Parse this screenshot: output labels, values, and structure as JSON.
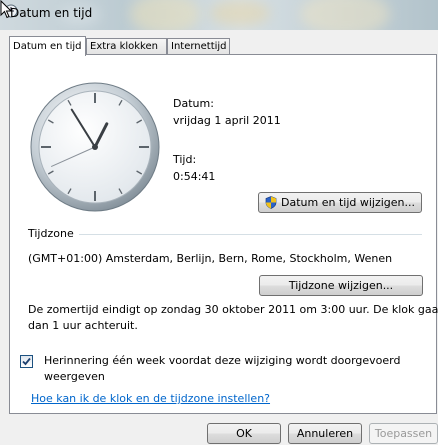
{
  "window": {
    "title": "Datum en tijd"
  },
  "tabs": [
    {
      "label": "Datum en tijd"
    },
    {
      "label": "Extra klokken"
    },
    {
      "label": "Internettijd"
    }
  ],
  "clock": {
    "hour": 0,
    "minute": 54,
    "second": 41
  },
  "date_section": {
    "date_label": "Datum:",
    "date_value": "vrijdag 1 april 2011",
    "time_label": "Tijd:",
    "time_value": "0:54:41",
    "change_button": "Datum en tijd wijzigen..."
  },
  "timezone": {
    "heading": "Tijdzone",
    "value": "(GMT+01:00) Amsterdam, Berlijn, Bern, Rome, Stockholm, Wenen",
    "change_button": "Tijdzone wijzigen...",
    "dst_line1": "De zomertijd eindigt op zondag 30 oktober 2011 om 3:00 uur. De klok gaat",
    "dst_line2": "dan 1 uur achteruit."
  },
  "reminder": {
    "checked": true,
    "line1": "Herinnering één week voordat deze wijziging wordt doorgevoerd",
    "line2": "weergeven"
  },
  "help_link": "Hoe kan ik de klok en de tijdzone instellen?",
  "footer": {
    "ok": "OK",
    "cancel": "Annuleren",
    "apply": "Toepassen"
  }
}
